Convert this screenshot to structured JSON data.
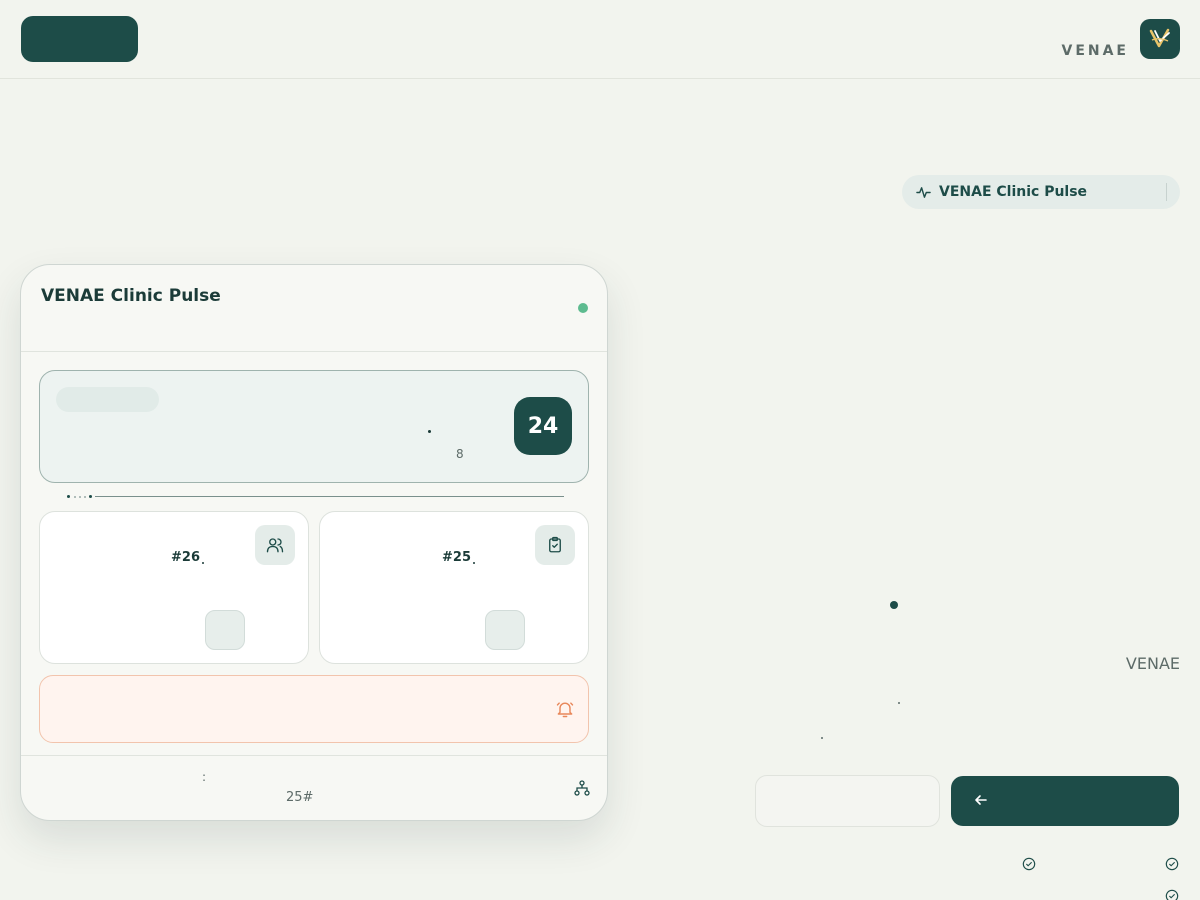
{
  "header": {
    "brand": "VENAE",
    "logo_icon": "venae-v-logo-icon",
    "menu_button_icon": "blank"
  },
  "pill": {
    "label": "VENAE Clinic Pulse",
    "icon": "activity-pulse-icon"
  },
  "card": {
    "title": "VENAE Clinic Pulse",
    "status_color": "#5dbb8f",
    "hero": {
      "count": "24",
      "sub_value": "8"
    },
    "progress": {
      "steps": 4,
      "current": 2
    },
    "tiles": [
      {
        "label": "#26",
        "icon": "users-icon"
      },
      {
        "label": "#25",
        "icon": "clipboard-check-icon"
      }
    ],
    "alert": {
      "icon": "bell-icon"
    },
    "footer": {
      "colon": ":",
      "code": "25#",
      "icon": "hierarchy-icon"
    }
  },
  "side": {
    "brand": "VENAE",
    "primary_button_icon": "arrow-left-icon"
  },
  "colors": {
    "primary": "#1d4c48",
    "background": "#f2f4ee",
    "accent_green": "#5dbb8f",
    "alert_orange": "#e8875a"
  }
}
